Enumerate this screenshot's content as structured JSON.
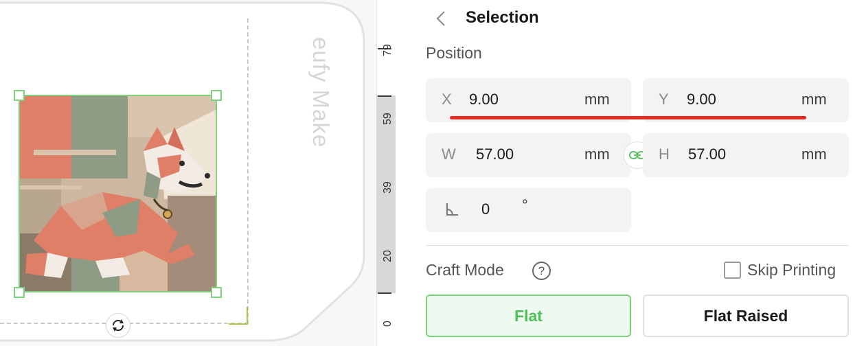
{
  "canvas": {
    "brand_watermark": "eufy Make",
    "ruler_labels": [
      "79",
      "59",
      "39",
      "20",
      "0"
    ]
  },
  "panel": {
    "title": "Selection",
    "position_label": "Position",
    "x": {
      "axis": "X",
      "value": "9.00",
      "unit": "mm"
    },
    "y": {
      "axis": "Y",
      "value": "9.00",
      "unit": "mm"
    },
    "w": {
      "axis": "W",
      "value": "57.00",
      "unit": "mm"
    },
    "h": {
      "axis": "H",
      "value": "57.00",
      "unit": "mm"
    },
    "rotation": {
      "value": "0",
      "unit": "°"
    },
    "craft_mode_label": "Craft Mode",
    "help_symbol": "?",
    "skip_printing_label": "Skip Printing",
    "skip_printing_checked": false,
    "modes": [
      {
        "label": "Flat",
        "selected": true
      },
      {
        "label": "Flat Raised",
        "selected": false
      }
    ]
  },
  "colors": {
    "accent_green": "#4fbf57",
    "selection_border": "#7ed07e",
    "annotation_red": "#e22b22"
  }
}
